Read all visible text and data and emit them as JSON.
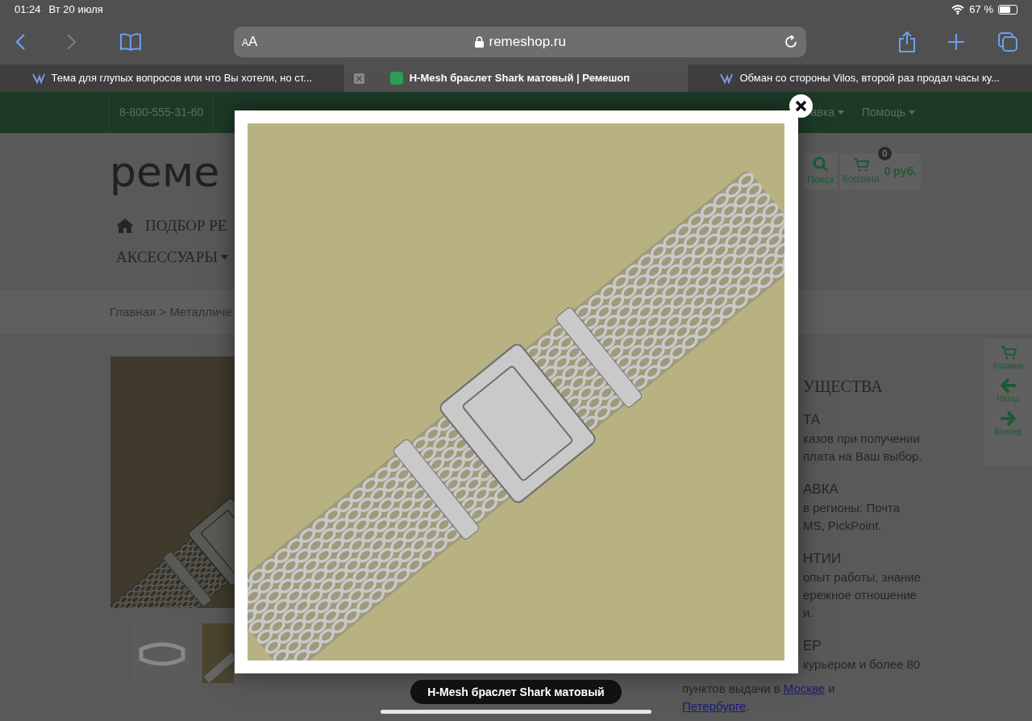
{
  "status_bar": {
    "time": "01:24",
    "date": "Вт 20 июля",
    "battery": "67 %"
  },
  "toolbar": {
    "text_size": "AA",
    "address": "remeshop.ru"
  },
  "tabs": [
    {
      "title": "Тема для глупых вопросов или что Вы хотели, но ст...",
      "selected": false,
      "kind": "forum"
    },
    {
      "title": "H-Mesh браслет Shark матовый | Ремешоп",
      "selected": true,
      "kind": "shop"
    },
    {
      "title": "Обман со стороны Vilos, второй раз продал часы ку...",
      "selected": false,
      "kind": "forum"
    }
  ],
  "top_nav": {
    "phone": "8-800-555-31-60",
    "items": [
      "авка",
      "Помощь"
    ]
  },
  "header": {
    "logo": "реме",
    "search_label": "Поиск",
    "cart_label": "Корзина",
    "cart_count": "0",
    "cart_total": "0 руб."
  },
  "menu": [
    "ПОДБОР РЕ",
    "АКСЕССУАРЫ"
  ],
  "breadcrumb": "Главная > Металличе",
  "advantages": {
    "heading": "УЩЕСТВА",
    "sections": [
      {
        "title": "ТА",
        "lines": [
          "казов при получении",
          "плата на Ваш выбор."
        ]
      },
      {
        "title": "АВКА",
        "lines": [
          "в регионы: Почта",
          "MS, PickPoint."
        ]
      },
      {
        "title": "НТИИ",
        "lines": [
          "опыт работы, знание",
          "ережное отношение",
          "и."
        ]
      },
      {
        "title": "ЕР",
        "lines": [
          "курьером и более 80"
        ]
      }
    ],
    "last_line": {
      "before": "пунктов выдачи в",
      "link": "Москве",
      "after": "и"
    },
    "last_link": "Петербурге",
    "last_end": "."
  },
  "side_panel": [
    {
      "kind": "cart",
      "label": "Корзина"
    },
    {
      "kind": "back",
      "label": "Назад"
    },
    {
      "kind": "forward",
      "label": "Вперед"
    }
  ],
  "lightbox": {
    "caption": "H-Mesh браслет Shark матовый"
  }
}
